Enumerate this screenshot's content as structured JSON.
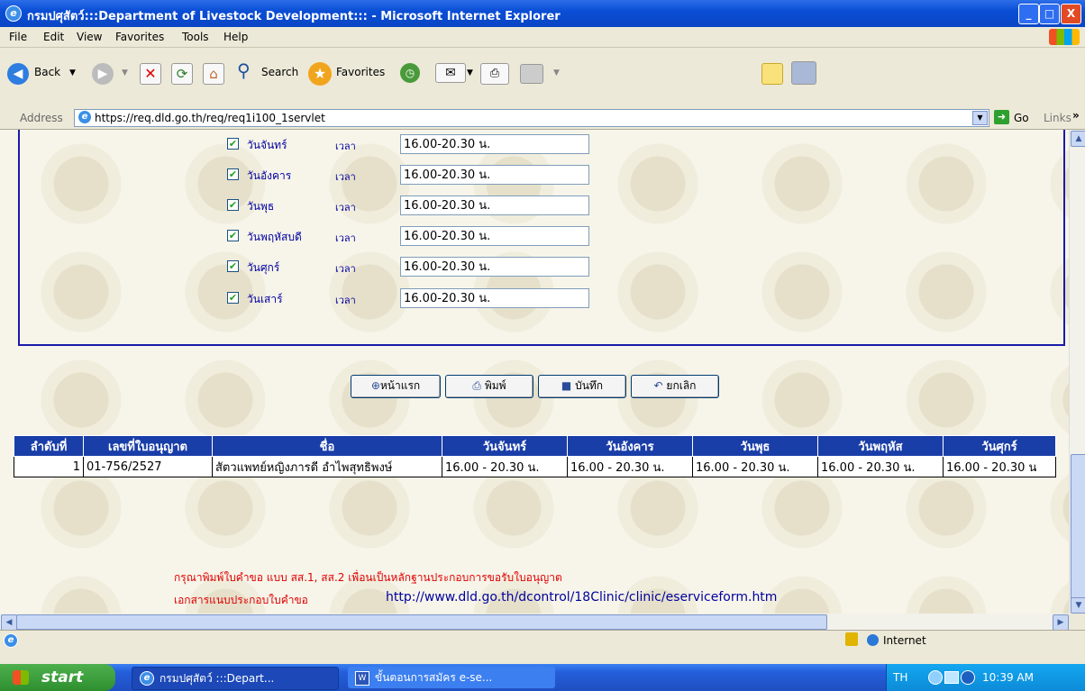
{
  "window": {
    "title": "กรมปศุสัตว์:::Department of Livestock Development::: - Microsoft Internet Explorer",
    "minimize": "_",
    "maximize": "□",
    "close": "X"
  },
  "menu": [
    "File",
    "Edit",
    "View",
    "Favorites",
    "Tools",
    "Help"
  ],
  "toolbar": {
    "back": "Back",
    "search": "Search",
    "favorites": "Favorites"
  },
  "address": {
    "label": "Address",
    "url": "https://req.dld.go.th/req/req1i100_1servlet",
    "go": "Go",
    "links": "Links",
    "more": "»"
  },
  "schedule": {
    "time_label": "เวลา",
    "rows": [
      {
        "day": "วันจันทร์",
        "time": "16.00-20.30 น.",
        "checked": true
      },
      {
        "day": "วันอังคาร",
        "time": "16.00-20.30 น.",
        "checked": true
      },
      {
        "day": "วันพุธ",
        "time": "16.00-20.30 น.",
        "checked": true
      },
      {
        "day": "วันพฤหัสบดี",
        "time": "16.00-20.30 น.",
        "checked": true
      },
      {
        "day": "วันศุกร์",
        "time": "16.00-20.30 น.",
        "checked": true
      },
      {
        "day": "วันเสาร์",
        "time": "16.00-20.30 น.",
        "checked": true
      }
    ]
  },
  "actions": {
    "home": "หน้าแรก",
    "print": "พิมพ์",
    "save": "บันทึก",
    "cancel": "ยกเลิก"
  },
  "table": {
    "headers": [
      "ลำดับที่",
      "เลขที่ใบอนุญาต",
      "ชื่อ",
      "วันจันทร์",
      "วันอังคาร",
      "วันพุธ",
      "วันพฤหัส",
      "วันศุกร์"
    ],
    "rows": [
      [
        "1",
        "01-756/2527",
        "สัตวแพทย์หญิงภารดี อำไพสุทธิพงษ์",
        "16.00 - 20.30 น.",
        "16.00 - 20.30 น.",
        "16.00 - 20.30 น.",
        "16.00 - 20.30 น.",
        "16.00 - 20.30 น"
      ]
    ]
  },
  "notes": {
    "print_request": "กรุณาพิมพ์ใบคำขอ แบบ สส.1, สส.2 เพื่อนเป็นหลักฐานประกอบการขอรับใบอนุญาต",
    "attachment_label": "เอกสารแนบประกอบใบคำขอ",
    "attachment_url": "http://www.dld.go.th/dcontrol/18Clinic/clinic/eserviceform.htm"
  },
  "statusbar": {
    "zone": "Internet"
  },
  "taskbar": {
    "start": "start",
    "tasks": [
      "กรมปศุสัตว์ :::Depart...",
      "ขั้นตอนการสมัคร e-se..."
    ],
    "lang": "TH",
    "clock": "10:39 AM"
  },
  "colors": {
    "accent": "#1a3ea8",
    "note_red": "#e00000",
    "link_blue": "#0000a0"
  }
}
